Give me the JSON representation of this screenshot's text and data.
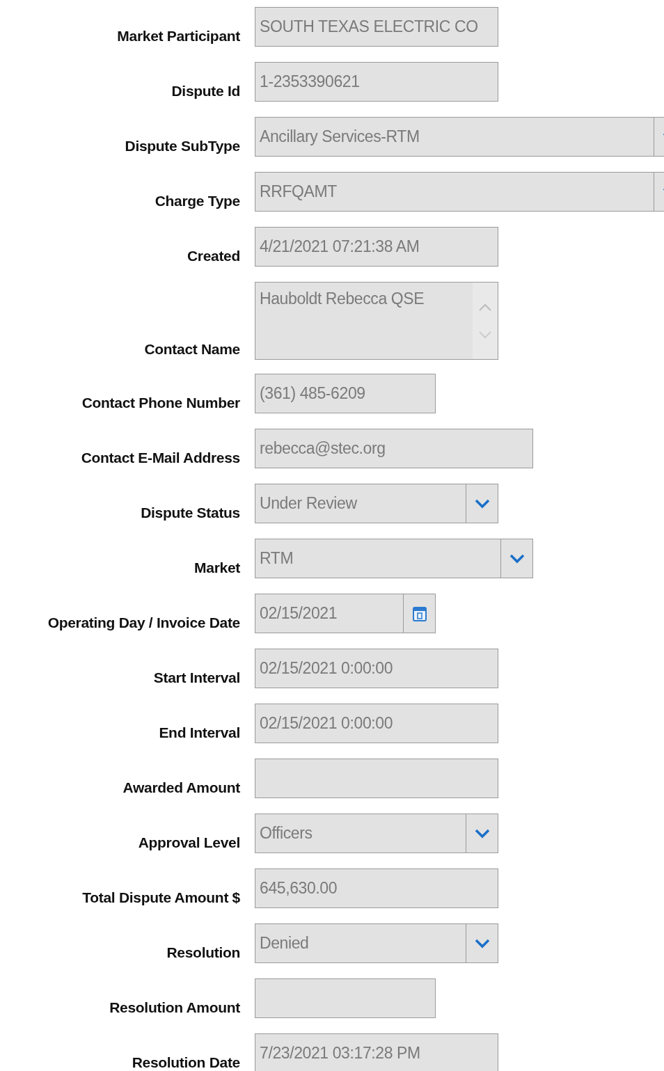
{
  "fields": [
    {
      "label": "Market Participant",
      "kind": "text",
      "value": "SOUTH TEXAS ELECTRIC CO"
    },
    {
      "label": "Dispute Id",
      "kind": "text",
      "value": "1-2353390621"
    },
    {
      "label": "Dispute SubType",
      "kind": "select",
      "value": "Ancillary Services-RTM"
    },
    {
      "label": "Charge Type",
      "kind": "select",
      "value": "RRFQAMT"
    },
    {
      "label": "Created",
      "kind": "text",
      "value": "4/21/2021 07:21:38 AM"
    },
    {
      "label": "Contact Name",
      "kind": "textarea",
      "value": "Hauboldt Rebecca QSE"
    },
    {
      "label": "Contact Phone Number",
      "kind": "text",
      "value": "(361) 485-6209"
    },
    {
      "label": "Contact E-Mail Address",
      "kind": "text",
      "value": "rebecca@stec.org"
    },
    {
      "label": "Dispute Status",
      "kind": "select",
      "value": "Under Review"
    },
    {
      "label": "Market",
      "kind": "select",
      "value": "RTM"
    },
    {
      "label": "Operating Day / Invoice Date",
      "kind": "date",
      "value": "02/15/2021"
    },
    {
      "label": "Start Interval",
      "kind": "text",
      "value": "02/15/2021 0:00:00"
    },
    {
      "label": "End Interval",
      "kind": "text",
      "value": "02/15/2021 0:00:00"
    },
    {
      "label": "Awarded Amount",
      "kind": "text"
    },
    {
      "label": "Approval Level",
      "kind": "select",
      "value": "Officers"
    },
    {
      "label": "Total Dispute Amount $",
      "kind": "text",
      "value": "645,630.00"
    },
    {
      "label": "Resolution",
      "kind": "select",
      "value": "Denied"
    },
    {
      "label": "Resolution Amount",
      "kind": "text"
    },
    {
      "label": "Resolution Date",
      "kind": "text",
      "value": "7/23/2021 03:17:28 PM"
    }
  ]
}
